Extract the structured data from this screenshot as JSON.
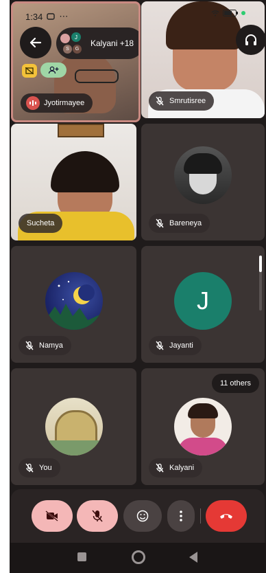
{
  "status_bar": {
    "time": "1:34"
  },
  "header": {
    "participants_label": "Kalyani +18",
    "mini_avatar_letters": [
      "J",
      "S",
      "G"
    ]
  },
  "tiles": [
    {
      "name": "Jyotirmayee",
      "speaking": true
    },
    {
      "name": "Smrutisree"
    },
    {
      "name": "Sucheta"
    },
    {
      "name": "Bareneya"
    },
    {
      "name": "Namya"
    },
    {
      "name": "Jayanti",
      "avatar_letter": "J"
    },
    {
      "name": "You"
    },
    {
      "name": "Kalyani"
    }
  ],
  "others_badge": "11 others",
  "colors": {
    "end_call": "#e53935",
    "off_button": "#f4b7b7",
    "jayanti_avatar": "#1a7f6b"
  }
}
